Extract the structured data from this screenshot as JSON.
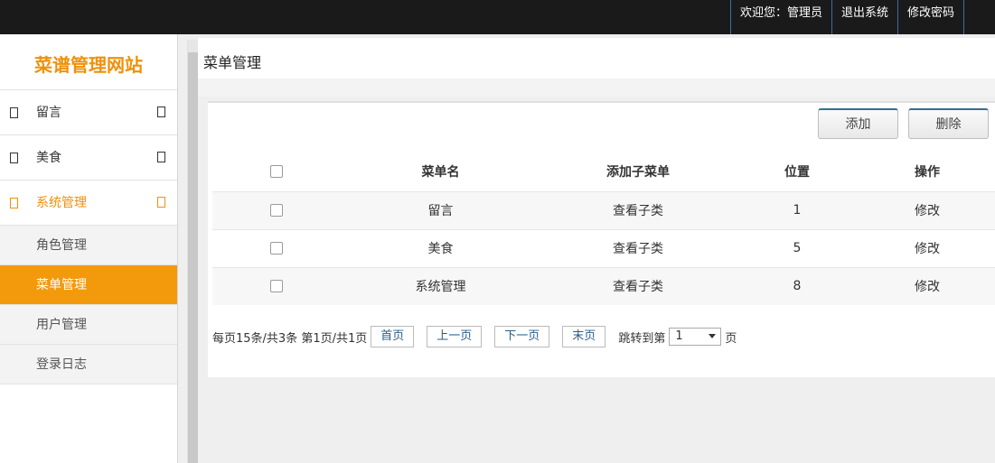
{
  "header": {
    "links": [
      "欢迎您：管理员",
      "退出系统",
      "修改密码"
    ]
  },
  "sidebar": {
    "logo": "菜谱管理网站",
    "items": [
      {
        "label": "留言"
      },
      {
        "label": "美食"
      },
      {
        "label": "系统管理"
      }
    ],
    "subitems": [
      "角色管理",
      "菜单管理",
      "用户管理",
      "登录日志"
    ]
  },
  "main": {
    "breadcrumb": "菜单管理",
    "toolbar": {
      "add_label": "添加",
      "delete_label": "删除"
    },
    "table": {
      "headers": [
        "菜单名",
        "添加子菜单",
        "位置",
        "操作"
      ],
      "rows": [
        {
          "name": "留言",
          "sub": "查看子类",
          "pos": "1",
          "op": "修改"
        },
        {
          "name": "美食",
          "sub": "查看子类",
          "pos": "5",
          "op": "修改"
        },
        {
          "name": "系统管理",
          "sub": "查看子类",
          "pos": "8",
          "op": "修改"
        }
      ]
    },
    "pager": {
      "summary": "每页15条/共3条 第1页/共1页",
      "first": "首页",
      "prev": "上一页",
      "next": "下一页",
      "last": "末页",
      "jump_prefix": "跳转到第",
      "jump_value": "1",
      "jump_suffix": "页"
    }
  },
  "colors": {
    "accent": "#f39a0c",
    "topbar": "#1a1a1a",
    "link": "#2a5d8a"
  }
}
